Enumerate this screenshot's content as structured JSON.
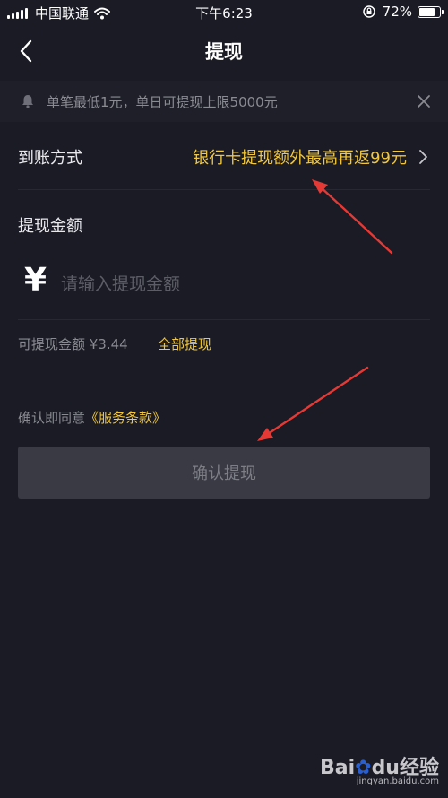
{
  "status_bar": {
    "carrier": "中国联通",
    "time": "下午6:23",
    "battery_percent_label": "72%",
    "battery_level": 0.72
  },
  "nav": {
    "title": "提现"
  },
  "notice": {
    "text": "单笔最低1元，单日可提现上限5000元"
  },
  "payout_method": {
    "label": "到账方式",
    "value": "银行卡提现额外最高再返99元"
  },
  "amount": {
    "title": "提现金额",
    "currency_symbol": "¥",
    "placeholder": "请输入提现金额",
    "value": ""
  },
  "available": {
    "text": "可提现金额 ¥3.44",
    "withdraw_all_label": "全部提现"
  },
  "agreement": {
    "prefix": "确认即同意",
    "terms_link": "《服务条款》"
  },
  "confirm_button": {
    "label": "确认提现"
  },
  "watermark": {
    "logo_text_bai": "Bai",
    "logo_text_du": "du",
    "logo_text_jingyan": "经验",
    "url": "jingyan.baidu.com"
  },
  "colors": {
    "background": "#1a1b24",
    "accent": "#f2c73b",
    "annotation_arrow": "#e53935",
    "button_bg": "#393a44"
  }
}
